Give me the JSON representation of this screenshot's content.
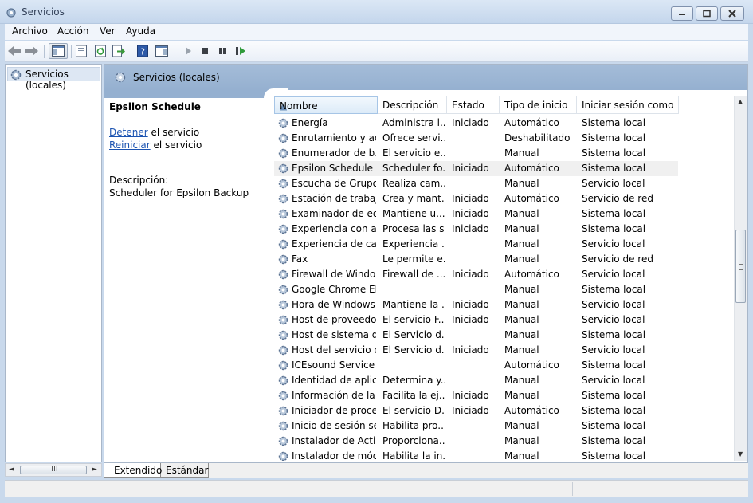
{
  "window": {
    "title": "Servicios"
  },
  "menu": [
    "Archivo",
    "Acción",
    "Ver",
    "Ayuda"
  ],
  "toolbar": [
    "back-icon",
    "forward-icon",
    "console-tree-icon",
    "properties-icon",
    "refresh-icon",
    "export-list-icon",
    "help-icon",
    "show-hide-icon",
    "start-icon",
    "stop-icon",
    "pause-icon",
    "restart-icon"
  ],
  "tree": {
    "root_label": "Servicios (locales)"
  },
  "pane": {
    "header_title": "Servicios (locales)"
  },
  "detail": {
    "service_name": "Epsilon Schedule",
    "stop_link": "Detener",
    "stop_suffix": " el servicio",
    "restart_link": "Reiniciar",
    "restart_suffix": " el servicio",
    "description_label": "Descripción:",
    "description_text": "Scheduler for Epsilon Backup"
  },
  "table": {
    "columns": [
      "Nombre",
      "Descripción",
      "Estado",
      "Tipo de inicio",
      "Iniciar sesión como"
    ],
    "sorted_column": "Nombre",
    "selected_row": "Epsilon Schedule",
    "rows": [
      [
        "Energía",
        "Administra l...",
        "Iniciado",
        "Automático",
        "Sistema local"
      ],
      [
        "Enrutamiento y ac...",
        "Ofrece servi...",
        "",
        "Deshabilitado",
        "Sistema local"
      ],
      [
        "Enumerador de b...",
        "El servicio e...",
        "",
        "Manual",
        "Sistema local"
      ],
      [
        "Epsilon Schedule",
        "Scheduler fo...",
        "Iniciado",
        "Automático",
        "Sistema local"
      ],
      [
        "Escucha de Grupo...",
        "Realiza cam...",
        "",
        "Manual",
        "Servicio local"
      ],
      [
        "Estación de trabajo",
        "Crea y mant...",
        "Iniciado",
        "Automático",
        "Servicio de red"
      ],
      [
        "Examinador de eq...",
        "Mantiene u...",
        "Iniciado",
        "Manual",
        "Sistema local"
      ],
      [
        "Experiencia con a...",
        "Procesa las s...",
        "Iniciado",
        "Manual",
        "Sistema local"
      ],
      [
        "Experiencia de cali...",
        "Experiencia ...",
        "",
        "Manual",
        "Servicio local"
      ],
      [
        "Fax",
        "Le permite e...",
        "",
        "Manual",
        "Servicio de red"
      ],
      [
        "Firewall de Windo...",
        "Firewall de ...",
        "Iniciado",
        "Automático",
        "Servicio local"
      ],
      [
        "Google Chrome El...",
        "",
        "",
        "Manual",
        "Sistema local"
      ],
      [
        "Hora de Windows",
        "Mantiene la ...",
        "Iniciado",
        "Manual",
        "Servicio local"
      ],
      [
        "Host de proveedo...",
        "El servicio F...",
        "Iniciado",
        "Manual",
        "Servicio local"
      ],
      [
        "Host de sistema d...",
        "El Servicio d...",
        "",
        "Manual",
        "Sistema local"
      ],
      [
        "Host del servicio d...",
        "El Servicio d...",
        "Iniciado",
        "Manual",
        "Servicio local"
      ],
      [
        "ICEsound Service",
        "",
        "",
        "Automático",
        "Sistema local"
      ],
      [
        "Identidad de aplic...",
        "Determina y...",
        "",
        "Manual",
        "Servicio local"
      ],
      [
        "Información de la ...",
        "Facilita la ej...",
        "Iniciado",
        "Manual",
        "Sistema local"
      ],
      [
        "Iniciador de proce...",
        "El servicio D...",
        "Iniciado",
        "Automático",
        "Sistema local"
      ],
      [
        "Inicio de sesión se...",
        "Habilita pro...",
        "",
        "Manual",
        "Sistema local"
      ],
      [
        "Instalador de Acti...",
        "Proporciona...",
        "",
        "Manual",
        "Sistema local"
      ],
      [
        "Instalador de mód...",
        "Habilita la in...",
        "",
        "Manual",
        "Sistema local"
      ]
    ]
  },
  "tabs": [
    "Extendido",
    "Estándar"
  ],
  "active_tab": "Extendido",
  "scrollbar_symbols": {
    "left": "◄",
    "right": "►",
    "up": "▲",
    "down": "▼",
    "grip": "III"
  }
}
